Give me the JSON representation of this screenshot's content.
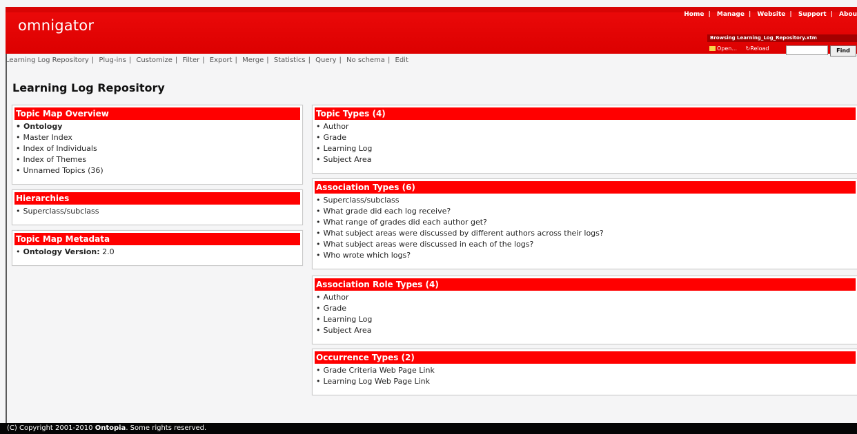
{
  "app": {
    "logo": "omnigator"
  },
  "top_links": [
    "Home",
    "Manage",
    "Website",
    "Support",
    "Abou"
  ],
  "browsing": "Browsing Learning_Log_Repository.xtm",
  "toolbar": {
    "open": "Open...",
    "reload": "Reload",
    "find_button": "Find"
  },
  "nav_links": [
    "Learning Log Repository",
    "Plug-ins",
    "Customize",
    "Filter",
    "Export",
    "Merge",
    "Statistics",
    "Query",
    "No schema",
    "Edit"
  ],
  "page_title": "Learning Log Repository",
  "panels": {
    "overview": {
      "title": "Topic Map Overview",
      "items": [
        "Ontology",
        "Master Index",
        "Index of Individuals",
        "Index of Themes",
        "Unnamed Topics (36)"
      ]
    },
    "hierarchies": {
      "title": "Hierarchies",
      "items": [
        "Superclass/subclass"
      ]
    },
    "metadata": {
      "title": "Topic Map Metadata",
      "label": "Ontology Version:",
      "value": "2.0"
    },
    "topic_types": {
      "title": "Topic Types (4)",
      "items": [
        "Author",
        "Grade",
        "Learning Log",
        "Subject Area"
      ]
    },
    "association_types": {
      "title": "Association Types (6)",
      "items": [
        "Superclass/subclass",
        "What grade did each log receive?",
        "What range of grades did each author get?",
        "What subject areas were discussed by different authors across their logs?",
        "What subject areas were discussed in each of the logs?",
        "Who wrote which logs?"
      ]
    },
    "role_types": {
      "title": "Association Role Types (4)",
      "items": [
        "Author",
        "Grade",
        "Learning Log",
        "Subject Area"
      ]
    },
    "occurrence_types": {
      "title": "Occurrence Types (2)",
      "items": [
        "Grade Criteria Web Page Link",
        "Learning Log Web Page Link"
      ]
    }
  },
  "footer": {
    "prefix": "(C) Copyright 2001-2010 ",
    "company": "Ontopia",
    "suffix": ". Some rights reserved."
  }
}
